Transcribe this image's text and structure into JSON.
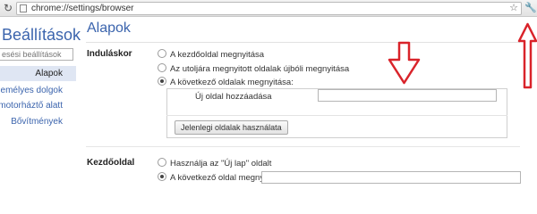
{
  "browser": {
    "url": "chrome://settings/browser",
    "reload_icon": "reload-icon",
    "star_icon": "star-icon",
    "wrench_icon": "wrench-icon"
  },
  "sidebar": {
    "title": "Beállítások",
    "search_placeholder": "esési beállítások",
    "items": [
      {
        "label": "Alapok",
        "active": true
      },
      {
        "label": "Személyes dolgok",
        "active": false
      },
      {
        "label": "A motorháztő alatt",
        "active": false
      },
      {
        "label": "Bővítmények",
        "active": false
      }
    ]
  },
  "main": {
    "title": "Alapok",
    "startup": {
      "label": "Induláskor",
      "options": [
        {
          "label": "A kezdőoldal megnyitása",
          "checked": false
        },
        {
          "label": "Az utoljára megnyitott oldalak újbóli megnyitása",
          "checked": false
        },
        {
          "label": "A következő oldalak megnyitása:",
          "checked": true
        }
      ],
      "new_page_label": "Új oldal hozzáadása",
      "new_page_value": "",
      "use_current_button": "Jelenlegi oldalak használata"
    },
    "homepage": {
      "label": "Kezdőoldal",
      "options": [
        {
          "label": "Használja az \"Új lap\" oldalt",
          "checked": false
        },
        {
          "label": "A következő oldal megnyitása:",
          "checked": true
        }
      ],
      "url_value": ""
    }
  },
  "annotation": {
    "color": "#d9232a"
  }
}
